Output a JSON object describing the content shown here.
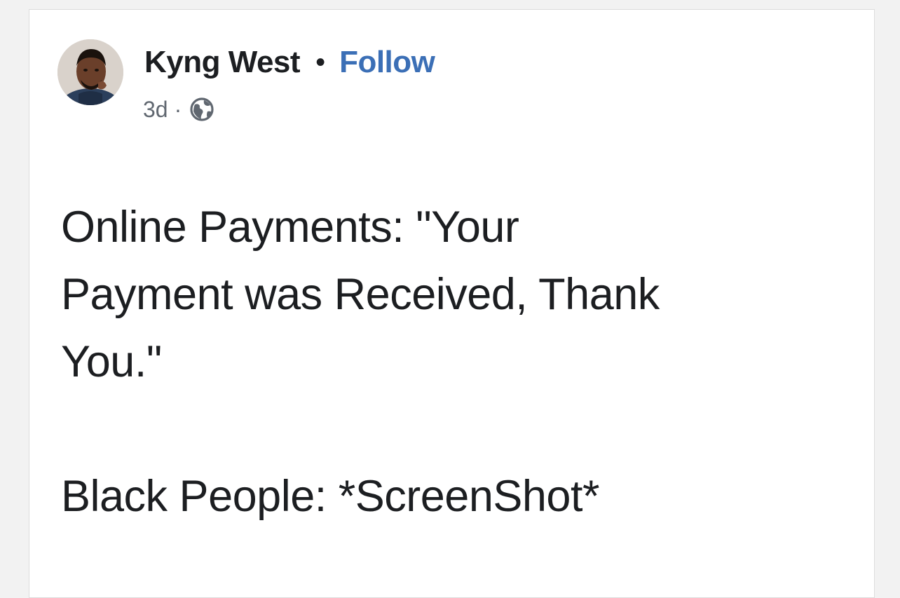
{
  "post": {
    "author": {
      "name": "Kyng West",
      "avatar_icon": "profile-photo"
    },
    "separator": "•",
    "follow_label": "Follow",
    "timestamp": "3d",
    "meta_separator": "·",
    "privacy_icon": "globe-icon",
    "body": {
      "lines": [
        "Online Payments: \"Your",
        "Payment was Received, Thank",
        "You.\""
      ],
      "second_paragraph": "Black People: *ScreenShot*"
    }
  },
  "colors": {
    "link": "#3b6fb6",
    "text": "#1c1e21",
    "muted": "#606770",
    "card_border": "#dcdcdc"
  }
}
